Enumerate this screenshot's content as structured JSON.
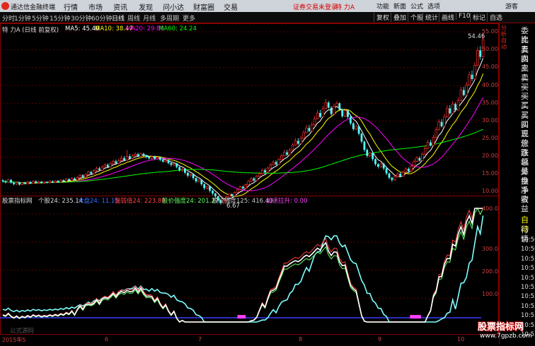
{
  "menubar": {
    "app_name": "通达信金融终端",
    "menus": [
      "行情",
      "市场",
      "资讯",
      "发现",
      "问小达",
      "财富圈",
      "交易"
    ],
    "alert": "证券交易未登录",
    "stock": "特 力A",
    "right_items": [
      "功能",
      "新面",
      "公式",
      "选项"
    ],
    "guest": "游客"
  },
  "toolbar": {
    "periods": [
      "分时",
      "1分钟",
      "5分钟",
      "15分钟",
      "30分钟",
      "60分钟",
      "日线",
      "周线",
      "月线",
      "多周期",
      "更多"
    ],
    "active_period": "日线",
    "buttons": [
      "复权",
      "叠加",
      "个股",
      "统计",
      "画线",
      "F10",
      "标记",
      "自选"
    ]
  },
  "main_chart": {
    "title": "特 力A (日线 前复权)",
    "ma_legend": [
      {
        "label": "MA5: 45.40",
        "color": "#ffffff"
      },
      {
        "label": "MA10: 38.47",
        "color": "#ffff00"
      },
      {
        "label": "MA20: 29.88",
        "color": "#ff00ff"
      },
      {
        "label": "MA60: 24.24",
        "color": "#00ff00"
      }
    ],
    "y_axis": [
      "55.00",
      "50.00",
      "45.00",
      "40.00",
      "35.00",
      "30.00",
      "25.00",
      "20.00",
      "15.00",
      "10.00"
    ],
    "high_label": "54.46",
    "low_label": "6.67"
  },
  "indicator": {
    "title": "股票指标网",
    "params": "个股24: 235.14",
    "legend": [
      {
        "label": "大盘24: 11.15",
        "color": "#3a70ff"
      },
      {
        "label": "强弱值24: 223.80",
        "color": "#ff4040"
      },
      {
        "label": "股价强度24: 201.27",
        "color": "#66ff66"
      },
      {
        "label": "股价强度125: 416.40",
        "color": "#cccccc"
      },
      {
        "label": "加速拉升: 0.00",
        "color": "#ff40ff"
      }
    ],
    "y_axis": [
      "400.0",
      "300.0",
      "200.0",
      "100.0"
    ],
    "formula_hint": "公式源码"
  },
  "x_axis": [
    "2015年5",
    "6",
    "7",
    "8",
    "9",
    "10"
  ],
  "sidepanel": {
    "title_vertical": "分析自动",
    "quote_labels": [
      "委比",
      "卖五",
      "卖四",
      "卖三",
      "卖二",
      "卖一",
      "买一",
      "买二",
      "买三",
      "买四",
      "买五",
      "现价",
      "涨跌",
      "涨幅",
      "总量",
      "外盘",
      "换手",
      "净资",
      "收益"
    ],
    "auto_label": "自动",
    "quote_label": "行情",
    "times": [
      "10:50",
      "10:50",
      "10:51",
      "10:51",
      "10:51",
      "10:52",
      "10:52",
      "10:52",
      "10:53",
      "10:53",
      "10:53"
    ]
  },
  "watermark": {
    "main": "股票指标网",
    "sub": "www.7gpzb.com"
  },
  "chart_data": {
    "type": "line",
    "candles": [
      [
        0,
        13.5,
        13.2,
        13.9,
        12.8
      ],
      [
        4,
        13.2,
        12.9,
        13.6,
        12.6
      ],
      [
        8,
        12.9,
        13.6,
        13.9,
        12.7
      ],
      [
        12,
        13.6,
        12.8,
        13.9,
        12.5
      ],
      [
        16,
        12.8,
        12.4,
        13.1,
        12.1
      ],
      [
        20,
        12.4,
        12.9,
        13.2,
        12.2
      ],
      [
        24,
        12.9,
        12.3,
        13.1,
        12.0
      ],
      [
        28,
        12.3,
        12.8,
        13.0,
        12.1
      ],
      [
        32,
        12.8,
        12.5,
        13.1,
        12.3
      ],
      [
        36,
        12.5,
        13.0,
        13.3,
        12.4
      ],
      [
        40,
        13.0,
        12.6,
        13.3,
        12.4
      ],
      [
        44,
        12.6,
        13.2,
        13.5,
        12.5
      ],
      [
        48,
        13.2,
        12.8,
        13.5,
        12.5
      ],
      [
        52,
        12.8,
        13.1,
        13.3,
        12.6
      ],
      [
        56,
        13.1,
        12.7,
        13.3,
        12.5
      ],
      [
        60,
        12.7,
        13.0,
        13.2,
        12.5
      ],
      [
        64,
        13.0,
        12.8,
        13.2,
        12.6
      ],
      [
        68,
        12.8,
        13.2,
        13.5,
        12.6
      ],
      [
        72,
        13.2,
        12.9,
        13.5,
        12.7
      ],
      [
        76,
        12.9,
        13.3,
        13.6,
        12.8
      ],
      [
        80,
        13.3,
        13.0,
        13.6,
        12.8
      ],
      [
        84,
        13.0,
        13.5,
        13.8,
        12.9
      ],
      [
        88,
        13.5,
        13.2,
        13.8,
        13.0
      ],
      [
        92,
        13.2,
        13.8,
        14.1,
        13.1
      ],
      [
        96,
        13.8,
        13.4,
        14.1,
        13.2
      ],
      [
        100,
        13.4,
        14.0,
        14.4,
        13.3
      ],
      [
        104,
        14.0,
        13.6,
        14.4,
        13.4
      ],
      [
        108,
        13.6,
        14.3,
        14.7,
        13.5
      ],
      [
        112,
        14.3,
        14.9,
        15.2,
        14.0
      ],
      [
        116,
        14.9,
        14.4,
        15.2,
        14.1
      ],
      [
        120,
        14.4,
        15.1,
        15.5,
        14.2
      ],
      [
        124,
        15.1,
        15.8,
        16.2,
        14.9
      ],
      [
        128,
        15.8,
        15.3,
        16.2,
        15.0
      ],
      [
        132,
        15.3,
        16.2,
        16.6,
        15.1
      ],
      [
        136,
        16.2,
        16.8,
        17.3,
        15.9
      ],
      [
        140,
        16.8,
        16.3,
        17.3,
        16.0
      ],
      [
        144,
        16.3,
        17.2,
        17.6,
        16.1
      ],
      [
        148,
        17.2,
        17.8,
        18.3,
        16.9
      ],
      [
        152,
        17.8,
        17.2,
        18.3,
        16.9
      ],
      [
        156,
        17.2,
        18.1,
        18.6,
        17.0
      ],
      [
        160,
        18.1,
        18.8,
        19.2,
        17.8
      ],
      [
        164,
        18.8,
        18.2,
        19.3,
        17.9
      ],
      [
        168,
        18.2,
        19.0,
        19.6,
        18.0
      ],
      [
        172,
        19.0,
        19.7,
        20.5,
        18.8
      ],
      [
        176,
        19.7,
        19.1,
        20.3,
        18.8
      ],
      [
        180,
        19.1,
        20.2,
        22.0,
        18.9
      ],
      [
        184,
        20.2,
        19.6,
        20.8,
        19.2
      ],
      [
        188,
        19.6,
        20.3,
        20.9,
        19.3
      ],
      [
        192,
        20.3,
        20.8,
        21.3,
        20.0
      ],
      [
        196,
        20.8,
        20.2,
        21.2,
        19.9
      ],
      [
        200,
        20.2,
        20.9,
        21.3,
        20.0
      ],
      [
        204,
        20.9,
        20.3,
        21.2,
        20.0
      ],
      [
        208,
        20.3,
        20.0,
        20.6,
        19.6
      ],
      [
        212,
        20.0,
        19.6,
        20.3,
        19.2
      ],
      [
        216,
        19.6,
        20.1,
        20.4,
        19.3
      ],
      [
        220,
        20.1,
        19.5,
        20.4,
        19.2
      ],
      [
        224,
        19.5,
        19.9,
        20.2,
        19.2
      ],
      [
        228,
        19.9,
        19.2,
        20.1,
        18.8
      ],
      [
        232,
        19.2,
        18.7,
        19.5,
        18.4
      ],
      [
        236,
        18.7,
        19.1,
        19.3,
        18.4
      ],
      [
        240,
        19.1,
        18.3,
        19.3,
        17.9
      ],
      [
        244,
        18.3,
        17.8,
        18.6,
        17.3
      ],
      [
        248,
        17.8,
        18.2,
        18.4,
        17.4
      ],
      [
        252,
        18.2,
        17.2,
        18.4,
        16.8
      ],
      [
        256,
        17.2,
        16.3,
        17.4,
        15.9
      ],
      [
        260,
        16.3,
        16.7,
        16.9,
        15.8
      ],
      [
        264,
        16.7,
        15.6,
        16.9,
        15.2
      ],
      [
        268,
        15.6,
        14.8,
        15.8,
        14.3
      ],
      [
        272,
        14.8,
        15.2,
        15.4,
        14.4
      ],
      [
        276,
        15.2,
        14.1,
        15.4,
        13.6
      ],
      [
        280,
        14.1,
        13.2,
        14.3,
        12.7
      ],
      [
        284,
        13.2,
        13.6,
        13.8,
        12.8
      ],
      [
        288,
        13.6,
        12.4,
        13.8,
        11.9
      ],
      [
        292,
        12.4,
        11.3,
        12.6,
        10.8
      ],
      [
        296,
        11.3,
        11.8,
        12.0,
        10.9
      ],
      [
        300,
        11.8,
        10.6,
        12.0,
        10.1
      ],
      [
        304,
        10.6,
        9.8,
        10.8,
        9.3
      ],
      [
        308,
        9.8,
        9.0,
        10.0,
        8.5
      ],
      [
        312,
        9.0,
        7.9,
        9.2,
        7.3
      ],
      [
        316,
        7.9,
        7.2,
        8.1,
        6.67
      ],
      [
        320,
        7.2,
        8.0,
        8.3,
        7.0
      ],
      [
        324,
        8.0,
        8.8,
        9.1,
        7.8
      ],
      [
        328,
        8.8,
        9.6,
        9.9,
        8.6
      ],
      [
        332,
        9.6,
        9.1,
        9.9,
        8.8
      ],
      [
        336,
        9.1,
        10.1,
        10.4,
        9.0
      ],
      [
        340,
        10.1,
        10.9,
        11.2,
        9.9
      ],
      [
        344,
        10.9,
        11.7,
        12.0,
        10.7
      ],
      [
        348,
        11.7,
        11.2,
        12.0,
        10.9
      ],
      [
        352,
        11.2,
        12.3,
        12.6,
        11.0
      ],
      [
        356,
        12.3,
        13.2,
        13.5,
        12.1
      ],
      [
        360,
        13.2,
        14.0,
        14.4,
        13.0
      ],
      [
        364,
        14.0,
        13.4,
        14.4,
        13.1
      ],
      [
        368,
        13.4,
        14.6,
        15.0,
        13.2
      ],
      [
        372,
        14.6,
        15.4,
        15.8,
        14.4
      ],
      [
        376,
        15.4,
        16.3,
        16.8,
        15.2
      ],
      [
        380,
        16.3,
        15.7,
        16.8,
        15.4
      ],
      [
        384,
        15.7,
        16.9,
        17.3,
        15.5
      ],
      [
        388,
        16.9,
        17.8,
        18.3,
        16.7
      ],
      [
        392,
        17.8,
        18.6,
        19.1,
        17.6
      ],
      [
        396,
        18.6,
        17.9,
        19.1,
        17.6
      ],
      [
        400,
        17.9,
        19.3,
        19.8,
        17.7
      ],
      [
        404,
        19.3,
        20.4,
        20.9,
        19.1
      ],
      [
        408,
        20.4,
        21.3,
        22.0,
        20.2
      ],
      [
        412,
        21.3,
        20.6,
        22.0,
        20.3
      ],
      [
        416,
        20.6,
        22.0,
        22.5,
        20.4
      ],
      [
        420,
        22.0,
        23.3,
        23.9,
        21.8
      ],
      [
        424,
        23.3,
        24.5,
        25.3,
        23.1
      ],
      [
        428,
        24.5,
        23.7,
        25.3,
        23.4
      ],
      [
        432,
        23.7,
        25.2,
        25.9,
        23.5
      ],
      [
        436,
        25.2,
        26.8,
        27.5,
        25.0
      ],
      [
        440,
        26.8,
        28.1,
        29.0,
        26.6
      ],
      [
        444,
        28.1,
        27.2,
        29.0,
        26.9
      ],
      [
        448,
        27.2,
        29.0,
        29.8,
        27.0
      ],
      [
        452,
        29.0,
        30.7,
        31.5,
        28.8
      ],
      [
        456,
        30.7,
        32.3,
        33.2,
        30.5
      ],
      [
        460,
        32.3,
        31.2,
        33.2,
        30.9
      ],
      [
        464,
        31.2,
        33.5,
        34.3,
        31.0
      ],
      [
        468,
        33.5,
        35.2,
        36.2,
        33.3
      ],
      [
        472,
        35.2,
        33.8,
        35.7,
        33.5
      ],
      [
        476,
        33.8,
        32.0,
        34.2,
        31.5
      ],
      [
        480,
        32.0,
        34.2,
        34.9,
        31.8
      ],
      [
        484,
        34.2,
        35.0,
        35.6,
        33.9
      ],
      [
        488,
        35.0,
        33.2,
        35.3,
        32.8
      ],
      [
        492,
        33.2,
        31.4,
        33.6,
        30.9
      ],
      [
        496,
        31.4,
        33.0,
        33.5,
        31.1
      ],
      [
        500,
        33.0,
        31.2,
        33.3,
        30.7
      ],
      [
        504,
        31.2,
        29.4,
        31.6,
        28.9
      ],
      [
        508,
        29.4,
        27.8,
        29.8,
        27.3
      ],
      [
        512,
        27.8,
        28.6,
        29.0,
        27.4
      ],
      [
        516,
        28.6,
        26.5,
        28.9,
        26.0
      ],
      [
        520,
        26.5,
        24.3,
        26.8,
        23.8
      ],
      [
        524,
        24.3,
        22.0,
        24.6,
        21.4
      ],
      [
        528,
        22.0,
        20.3,
        22.4,
        19.8
      ],
      [
        532,
        20.3,
        21.1,
        21.5,
        19.9
      ],
      [
        536,
        21.1,
        19.4,
        21.4,
        18.9
      ],
      [
        540,
        19.4,
        18.0,
        19.7,
        17.5
      ],
      [
        544,
        18.0,
        17.3,
        18.3,
        16.8
      ],
      [
        548,
        17.3,
        18.1,
        18.4,
        16.9
      ],
      [
        552,
        18.1,
        16.8,
        18.4,
        16.3
      ],
      [
        556,
        16.8,
        15.4,
        17.1,
        14.9
      ],
      [
        560,
        15.4,
        14.2,
        15.7,
        13.7
      ],
      [
        564,
        14.2,
        13.6,
        14.5,
        13.0
      ],
      [
        568,
        13.6,
        14.5,
        14.9,
        13.3
      ],
      [
        572,
        14.5,
        15.3,
        15.7,
        14.2
      ],
      [
        576,
        15.3,
        14.6,
        15.7,
        14.3
      ],
      [
        580,
        14.6,
        15.8,
        16.2,
        14.4
      ],
      [
        584,
        15.8,
        16.7,
        17.1,
        15.6
      ],
      [
        588,
        16.7,
        16.0,
        17.1,
        15.7
      ],
      [
        592,
        16.0,
        17.5,
        17.9,
        15.8
      ],
      [
        596,
        17.5,
        18.8,
        19.4,
        17.3
      ],
      [
        600,
        18.8,
        19.7,
        20.2,
        18.5
      ],
      [
        604,
        19.7,
        19.0,
        20.2,
        18.7
      ],
      [
        608,
        19.0,
        20.8,
        21.3,
        18.8
      ],
      [
        612,
        20.8,
        22.4,
        23.1,
        20.6
      ],
      [
        616,
        22.4,
        24.1,
        24.8,
        22.2
      ],
      [
        620,
        24.1,
        23.2,
        24.8,
        22.9
      ],
      [
        624,
        23.2,
        25.5,
        26.2,
        23.0
      ],
      [
        628,
        25.5,
        27.6,
        28.4,
        25.3
      ],
      [
        632,
        27.6,
        29.8,
        30.6,
        27.4
      ],
      [
        636,
        29.8,
        28.6,
        30.6,
        28.2
      ],
      [
        640,
        28.6,
        31.2,
        32.1,
        28.4
      ],
      [
        644,
        31.2,
        33.6,
        34.5,
        31.0
      ],
      [
        648,
        33.6,
        32.2,
        34.5,
        31.8
      ],
      [
        652,
        32.2,
        34.8,
        35.7,
        32.0
      ],
      [
        656,
        34.8,
        33.1,
        35.3,
        32.7
      ],
      [
        660,
        33.1,
        35.8,
        36.7,
        32.9
      ],
      [
        664,
        35.8,
        38.7,
        39.6,
        35.6
      ],
      [
        668,
        38.7,
        37.3,
        39.6,
        36.9
      ],
      [
        672,
        37.3,
        40.1,
        41.0,
        37.1
      ],
      [
        676,
        40.1,
        43.0,
        43.9,
        39.9
      ],
      [
        680,
        43.0,
        41.8,
        44.2,
        41.2
      ],
      [
        684,
        41.8,
        45.6,
        46.5,
        41.6
      ],
      [
        688,
        45.6,
        49.8,
        50.8,
        45.4
      ],
      [
        692,
        49.8,
        48.0,
        51.0,
        47.2
      ],
      [
        696,
        48.0,
        52.8,
        54.46,
        47.8
      ]
    ],
    "ma5_shape": "follows price with lag",
    "ma10_shape": "smoother price follower",
    "ma20_shape": "slow wave",
    "ma60_shape": "slow rising baseline"
  }
}
